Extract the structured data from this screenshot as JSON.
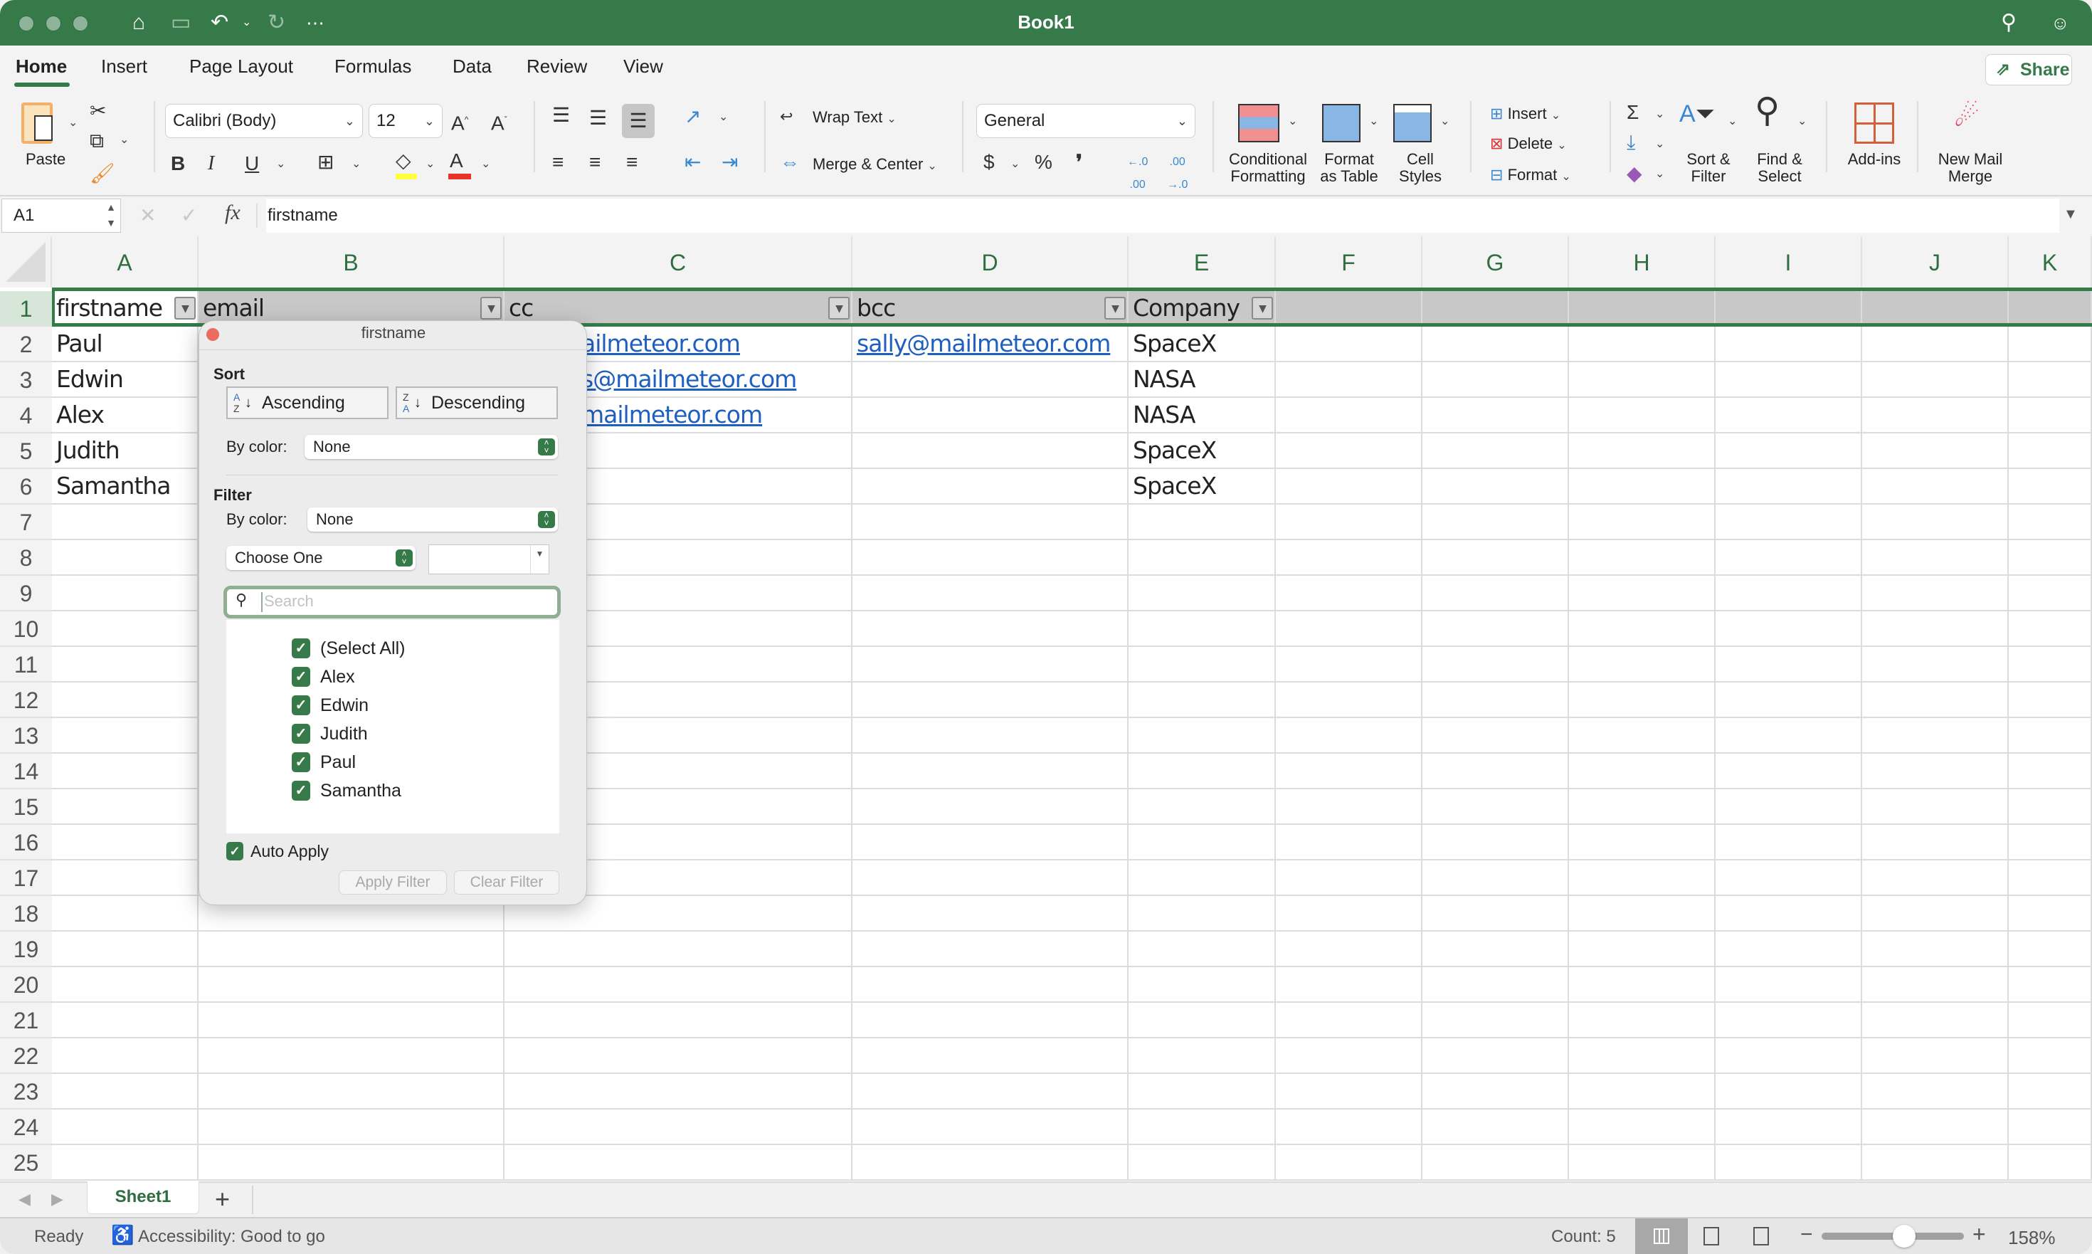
{
  "window": {
    "title": "Book1"
  },
  "titlebar": {
    "icons": [
      "home-icon",
      "save-icon",
      "undo-icon",
      "chevron-down-icon",
      "redo-icon",
      "more-icon",
      "search-icon",
      "collaborate-icon"
    ]
  },
  "tabs": [
    {
      "label": "Home",
      "active": true
    },
    {
      "label": "Insert"
    },
    {
      "label": "Page Layout"
    },
    {
      "label": "Formulas"
    },
    {
      "label": "Data"
    },
    {
      "label": "Review"
    },
    {
      "label": "View"
    }
  ],
  "share_label": "Share",
  "ribbon": {
    "paste_label": "Paste",
    "font_name": "Calibri (Body)",
    "font_size": "12",
    "bold": "B",
    "italic": "I",
    "underline": "U",
    "wrap_text": "Wrap Text",
    "merge_center": "Merge & Center",
    "number_format": "General",
    "currency": "$",
    "percent": "%",
    "comma": "❜",
    "conditional_formatting": [
      "Conditional",
      "Formatting"
    ],
    "format_as_table": [
      "Format",
      "as Table"
    ],
    "cell_styles": [
      "Cell",
      "Styles"
    ],
    "insert": "Insert",
    "delete": "Delete",
    "format": "Format",
    "sort_filter": [
      "Sort &",
      "Filter"
    ],
    "find_select": [
      "Find &",
      "Select"
    ],
    "addins": "Add-ins",
    "new_mail_merge": [
      "New Mail",
      "Merge"
    ],
    "colors": {
      "highlight": "#ffff40",
      "font_color": "#e8322a"
    }
  },
  "formula_bar": {
    "name_box": "A1",
    "fx": "fx",
    "content": "firstname"
  },
  "columns": [
    "A",
    "B",
    "C",
    "D",
    "E",
    "F",
    "G",
    "H",
    "I",
    "J",
    "K"
  ],
  "rows": [
    "1",
    "2",
    "3",
    "4",
    "5",
    "6",
    "7",
    "8",
    "9",
    "10",
    "11",
    "12",
    "13",
    "14",
    "15",
    "16",
    "17",
    "18",
    "19",
    "20",
    "21",
    "22",
    "23",
    "24",
    "25"
  ],
  "table": {
    "headers": [
      "firstname",
      "email",
      "cc",
      "bcc",
      "Company"
    ],
    "rows": [
      {
        "firstname": "Paul",
        "cc": "ailmeteor.com",
        "bcc": "sally@mailmeteor.com",
        "company": "SpaceX"
      },
      {
        "firstname": "Edwin",
        "cc": "s@mailmeteor.com",
        "bcc": "",
        "company": "NASA"
      },
      {
        "firstname": "Alex",
        "cc": "mailmeteor.com",
        "bcc": "",
        "company": "NASA"
      },
      {
        "firstname": "Judith",
        "cc": "",
        "bcc": "",
        "company": "SpaceX"
      },
      {
        "firstname": "Samantha",
        "cc": "",
        "bcc": "",
        "company": "SpaceX"
      }
    ]
  },
  "filter_popup": {
    "title": "firstname",
    "sort_heading": "Sort",
    "ascending": "Ascending",
    "descending": "Descending",
    "sort_by_color_label": "By color:",
    "sort_by_color_value": "None",
    "filter_heading": "Filter",
    "filter_by_color_label": "By color:",
    "filter_by_color_value": "None",
    "condition": "Choose One",
    "condition_value": "",
    "search_placeholder": "Search",
    "items": [
      {
        "label": "(Select All)",
        "checked": true
      },
      {
        "label": "Alex",
        "checked": true
      },
      {
        "label": "Edwin",
        "checked": true
      },
      {
        "label": "Judith",
        "checked": true
      },
      {
        "label": "Paul",
        "checked": true
      },
      {
        "label": "Samantha",
        "checked": true
      }
    ],
    "auto_apply_label": "Auto Apply",
    "auto_apply_checked": true,
    "apply_filter": "Apply Filter",
    "clear_filter": "Clear Filter"
  },
  "sheet_tabs": {
    "active": "Sheet1",
    "add": "+"
  },
  "status": {
    "ready": "Ready",
    "accessibility": "Accessibility: Good to go",
    "count": "Count: 5",
    "zoom_minus": "−",
    "zoom_plus": "+",
    "zoom_level": "158%",
    "zoom_slider_fraction": 0.58
  },
  "accent_color": "#367a4a"
}
